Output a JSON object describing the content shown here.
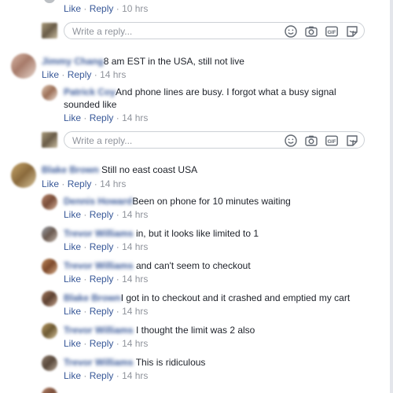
{
  "colors": {
    "link": "#385898",
    "meta": "#90949c",
    "text": "#1d2129",
    "border": "#ccd0d5"
  },
  "actions": {
    "like": "Like",
    "reply": "Reply",
    "separator": "·"
  },
  "reply_box": {
    "placeholder": "Write a reply..."
  },
  "reply_icons": [
    "emoji-icon",
    "camera-icon",
    "gif-icon",
    "sticker-icon"
  ],
  "top_fragment": {
    "time": "10 hrs"
  },
  "threads": [
    {
      "author": "Jimmy Chang",
      "text": "8 am EST in the USA, still not live",
      "time": "14 hrs",
      "replies": [
        {
          "author": "Patrick Coy",
          "text": "And phone lines are busy. I forgot what a busy signal sounded like",
          "time": "14 hrs"
        }
      ]
    },
    {
      "author": "Blake Brown",
      "text": "Still no east coast USA",
      "time": "14 hrs",
      "replies": [
        {
          "author": "Dennis Howard",
          "text": "Been on phone for 10 minutes waiting",
          "time": "14 hrs"
        },
        {
          "author": "Trevor Williams",
          "text": "in, but it looks like limited to 1",
          "time": "14 hrs"
        },
        {
          "author": "Trevor Williams",
          "text": "and can't seem to checkout",
          "time": "14 hrs"
        },
        {
          "author": "Blake Brown",
          "text": "I got in to checkout and it crashed and emptied my cart",
          "time": "14 hrs"
        },
        {
          "author": "Trevor Williams",
          "text": "I thought the limit was 2 also",
          "time": "14 hrs"
        },
        {
          "author": "Trevor Williams",
          "text": "This is ridiculous",
          "time": "14 hrs"
        }
      ]
    }
  ]
}
